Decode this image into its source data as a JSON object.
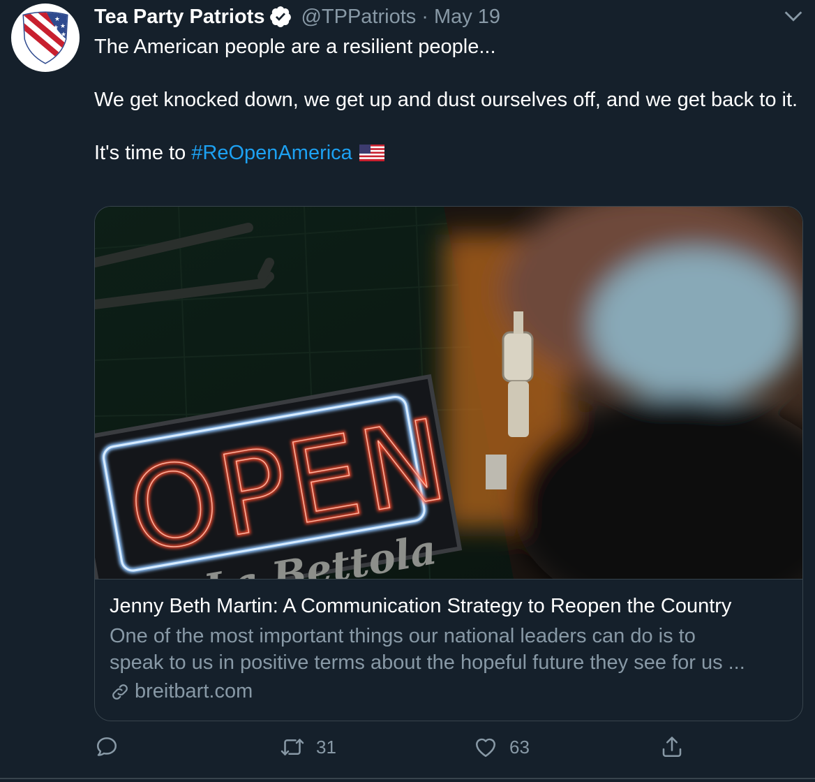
{
  "tweet": {
    "author_name": "Tea Party Patriots",
    "handle": "@TPPatriots",
    "separator": "·",
    "date": "May 19",
    "text_line1": "The American people are a resilient people...",
    "text_line2": "We get knocked down, we get up and dust ourselves off, and we get back to it.",
    "text_line3_prefix": "It's time to ",
    "hashtag": "#ReOpenAmerica"
  },
  "card": {
    "image_sign_text": "OPEN",
    "image_script_text": "La Bettola",
    "title": "Jenny Beth Martin: A Communication Strategy to Reopen the Country",
    "description_line1": "One of the most important things our national leaders can do is to",
    "description_line2": "speak to us in positive terms about the hopeful future they see for us ...",
    "domain": "breitbart.com"
  },
  "actions": {
    "reply_count": "",
    "retweet_count": "31",
    "like_count": "63"
  },
  "colors": {
    "background": "#15202b",
    "text": "#ffffff",
    "muted": "#8899a6",
    "accent": "#1da1f2",
    "border": "#38444d"
  },
  "icons": {
    "verified": "verified-badge-icon",
    "menu": "chevron-down-icon",
    "flag": "us-flag-emoji",
    "link": "link-icon",
    "reply": "reply-icon",
    "retweet": "retweet-icon",
    "like": "heart-icon",
    "share": "share-icon"
  }
}
